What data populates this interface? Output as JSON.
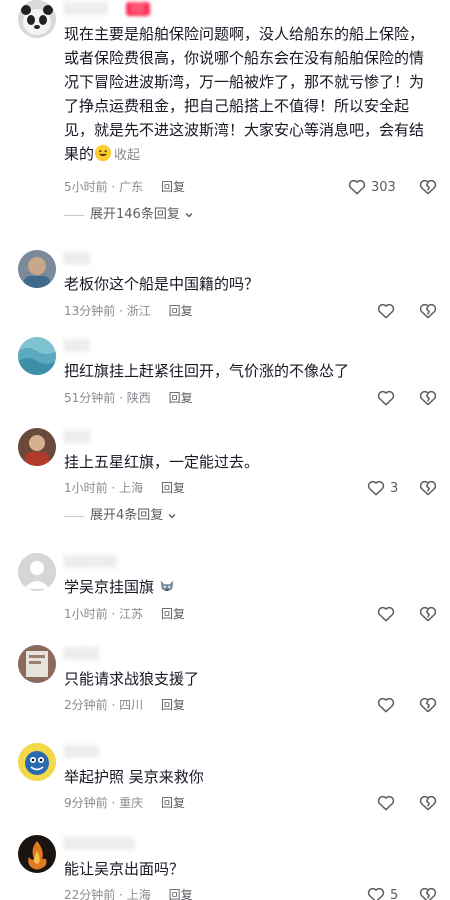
{
  "comments": [
    {
      "username": "░░░░░",
      "badge": "░░",
      "text": "现在主要是船舶保险问题啊，没人给船东的船上保险，或者保险费很高，你说哪个船东会在没有船舶保险的情况下冒险进波斯湾，万一船被炸了，那不就亏惨了！为了挣点运费租金，把自己船搭上不值得！所以安全起见，就是先不进这波斯湾！大家安心等消息吧，会有结果的",
      "collapse_label": "收起",
      "time": "5小时前",
      "location": "广东",
      "reply_label": "回复",
      "likes": "303",
      "expand_label": "展开146条回复"
    },
    {
      "username": "░░░",
      "text": "老板你这个船是中国籍的吗？",
      "time": "13分钟前",
      "location": "浙江",
      "reply_label": "回复",
      "likes": ""
    },
    {
      "username": "░░░",
      "text": "把红旗挂上赶紧往回开，气价涨的不像怂了",
      "time": "51分钟前",
      "location": "陕西",
      "reply_label": "回复",
      "likes": ""
    },
    {
      "username": "░░░",
      "text": "挂上五星红旗，一定能过去。",
      "time": "1小时前",
      "location": "上海",
      "reply_label": "回复",
      "likes": "3",
      "expand_label": "展开4条回复"
    },
    {
      "username": "░░░░░░",
      "text": "学吴京挂国旗",
      "time": "1小时前",
      "location": "江苏",
      "reply_label": "回复",
      "likes": ""
    },
    {
      "username": "░░░░",
      "text": "只能请求战狼支援了",
      "time": "2分钟前",
      "location": "四川",
      "reply_label": "回复",
      "likes": ""
    },
    {
      "username": "░░░░",
      "text": "举起护照 吴京来救你",
      "time": "9分钟前",
      "location": "重庆",
      "reply_label": "回复",
      "likes": ""
    },
    {
      "username": "░░░░░░░░",
      "text": "能让吴京出面吗？",
      "time": "22分钟前",
      "location": "上海",
      "reply_label": "回复",
      "likes": "5"
    }
  ],
  "separator": "·",
  "colors": {
    "text": "#161823",
    "meta": "#8a8b91",
    "badge": "#fe2c55"
  }
}
